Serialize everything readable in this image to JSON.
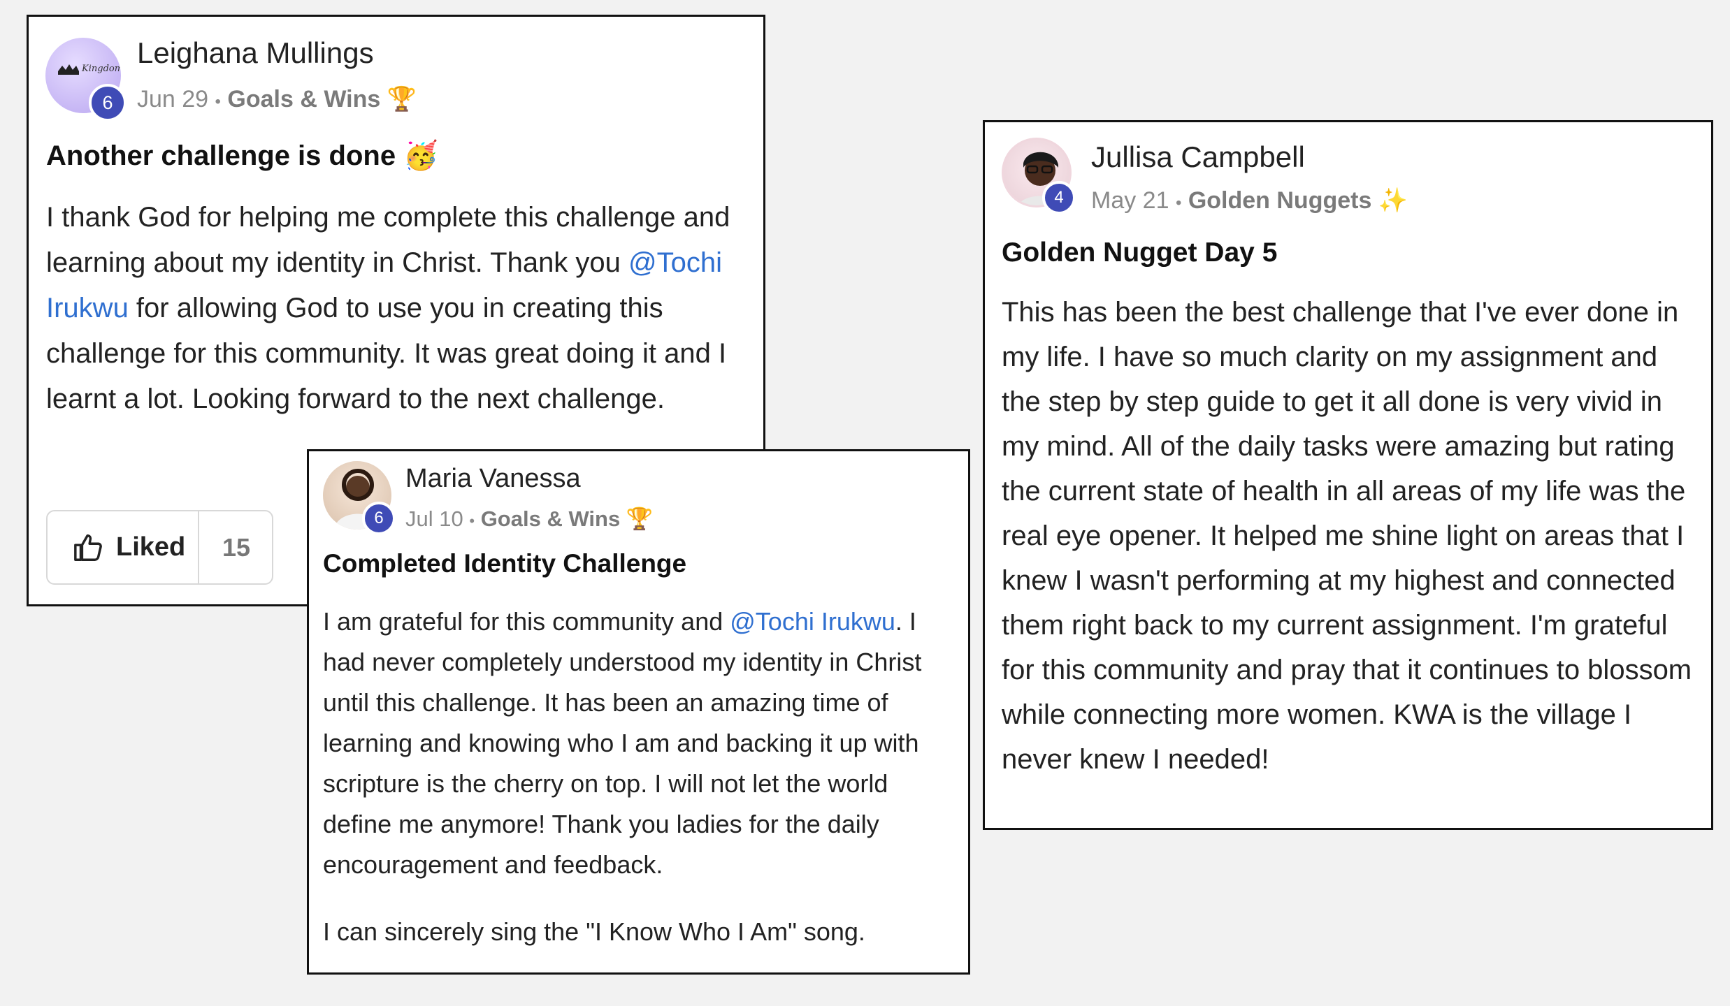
{
  "posts": [
    {
      "author": "Leighana Mullings",
      "level": "6",
      "date": "Jun 29",
      "separator": "•",
      "category": "Goals & Wins",
      "category_emoji": "🏆",
      "title": "Another challenge is done",
      "title_emoji": "🥳",
      "body_parts": [
        "I thank God for helping me complete this challenge and learning about my identity in Christ. Thank you ",
        "@Tochi Irukwu",
        " for allowing God to use you in creating this challenge for this community. It was great doing it and I learnt a lot. Looking forward to the next challenge."
      ],
      "like_label": "Liked",
      "like_count": "15",
      "avatar_text": "Kingdom M"
    },
    {
      "author": "Maria Vanessa",
      "level": "6",
      "date": "Jul 10",
      "separator": "•",
      "category": "Goals & Wins",
      "category_emoji": "🏆",
      "title": "Completed Identity Challenge",
      "body_parts": [
        "I am grateful for this community and ",
        "@Tochi Irukwu",
        ". I had never completely understood my identity in Christ until this challenge. It has been an amazing time of learning and knowing who I am and backing it up with scripture is the cherry on top. I will not let the world define me anymore! Thank you ladies for the daily encouragement and feedback."
      ],
      "body_p2": "I can sincerely sing the \"I Know Who I Am\" song."
    },
    {
      "author": "Jullisa Campbell",
      "level": "4",
      "date": "May 21",
      "separator": "•",
      "category": "Golden Nuggets",
      "category_emoji": "✨",
      "title": "Golden Nugget Day 5",
      "body": "This has been the best challenge that I've ever done in my life. I have so much clarity on my assignment and the step by step guide to get it all done is very vivid in my mind. All of the daily tasks were amazing but rating the current state of health in all areas of my life was the real eye opener. It helped me shine light on areas that I knew I wasn't performing at my highest and connected them right back to my current assignment. I'm grateful for this community and pray that it continues to blossom while connecting more women. KWA is the village I never knew I needed!"
    }
  ],
  "colors": {
    "mention": "#2f6fd0",
    "level_badge": "#3f4bb6"
  }
}
